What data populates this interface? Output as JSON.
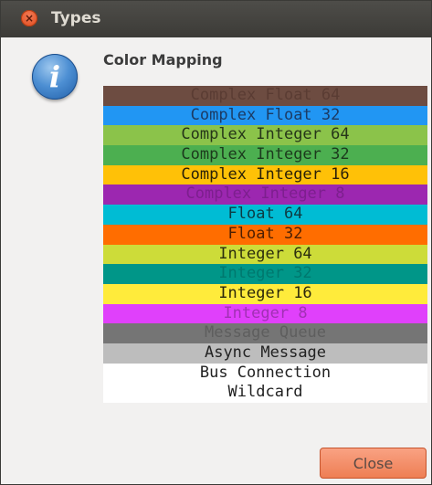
{
  "window": {
    "title": "Types"
  },
  "dialog": {
    "heading": "Color Mapping",
    "close_label": "Close"
  },
  "color_mapping": [
    {
      "label": "Complex Float 64",
      "bg": "#6d4c41",
      "fg": "#5a3c33"
    },
    {
      "label": "Complex Float 32",
      "bg": "#2196f3",
      "fg": "#1c3b64"
    },
    {
      "label": "Complex Integer 64",
      "bg": "#8bc34a",
      "fg": "#263619"
    },
    {
      "label": "Complex Integer 32",
      "bg": "#4caf50",
      "fg": "#1c3a1d"
    },
    {
      "label": "Complex Integer 16",
      "bg": "#ffc107",
      "fg": "#2b2108"
    },
    {
      "label": "Complex Integer 8",
      "bg": "#9c27b0",
      "fg": "#7d1f8e"
    },
    {
      "label": "Float 64",
      "bg": "#00bcd4",
      "fg": "#0e3b42"
    },
    {
      "label": "Float 32",
      "bg": "#ff6d00",
      "fg": "#4b1f04"
    },
    {
      "label": "Integer 64",
      "bg": "#cddc39",
      "fg": "#2b2e0e"
    },
    {
      "label": "Integer 32",
      "bg": "#009688",
      "fg": "#00786e"
    },
    {
      "label": "Integer 16",
      "bg": "#ffeb3b",
      "fg": "#2a270b"
    },
    {
      "label": "Integer 8",
      "bg": "#e040fb",
      "fg": "#a130b4"
    },
    {
      "label": "Message Queue",
      "bg": "#757575",
      "fg": "#5e5e5e"
    },
    {
      "label": "Async Message",
      "bg": "#bdbdbd",
      "fg": "#222222"
    },
    {
      "label": "Bus Connection",
      "bg": "#ffffff",
      "fg": "#222222"
    },
    {
      "label": "Wildcard",
      "bg": "#ffffff",
      "fg": "#222222"
    }
  ],
  "icons": {
    "window_close": "close-x",
    "dialog": "info-i"
  }
}
